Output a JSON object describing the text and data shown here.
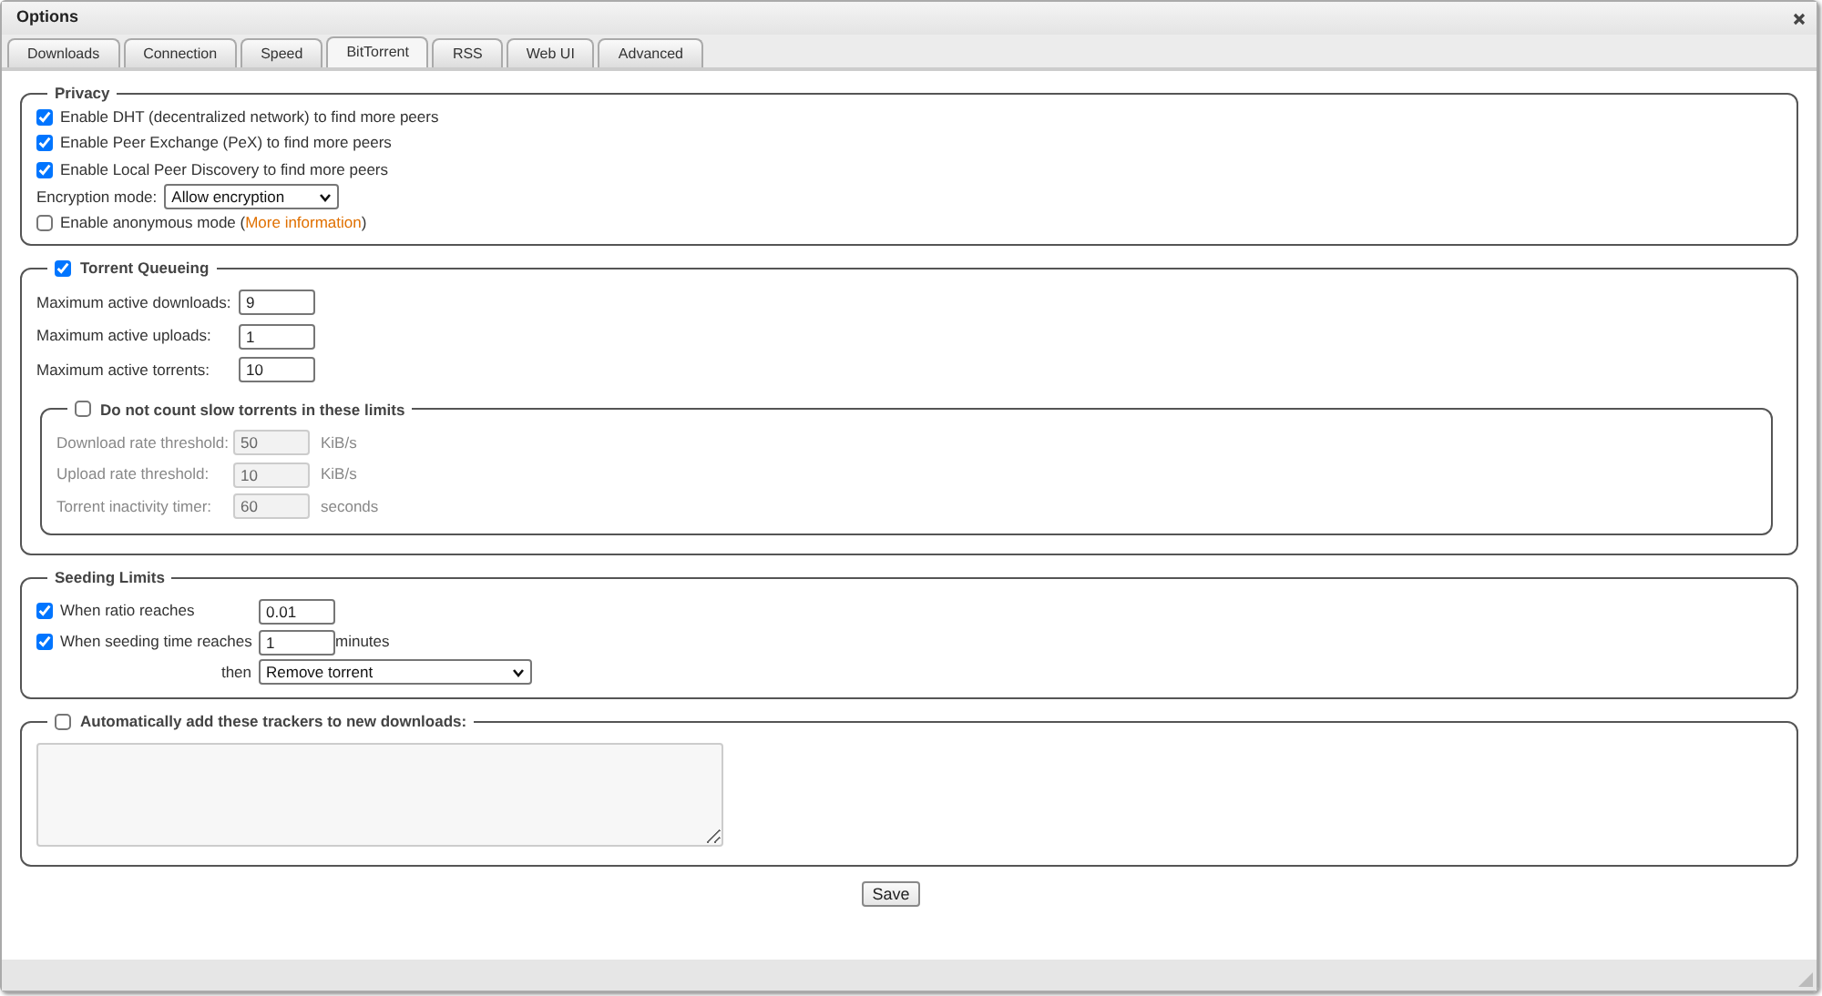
{
  "window": {
    "title": "Options"
  },
  "tabs": [
    {
      "label": "Downloads",
      "selected": false
    },
    {
      "label": "Connection",
      "selected": false
    },
    {
      "label": "Speed",
      "selected": false
    },
    {
      "label": "BitTorrent",
      "selected": true
    },
    {
      "label": "RSS",
      "selected": false
    },
    {
      "label": "Web UI",
      "selected": false
    },
    {
      "label": "Advanced",
      "selected": false
    }
  ],
  "privacy": {
    "legend": "Privacy",
    "options": [
      {
        "label": "Enable DHT (decentralized network) to find more peers",
        "checked": true
      },
      {
        "label": "Enable Peer Exchange (PeX) to find more peers",
        "checked": true
      },
      {
        "label": "Enable Local Peer Discovery to find more peers",
        "checked": true
      }
    ],
    "encryption": {
      "label": "Encryption mode:",
      "value": "Allow encryption"
    },
    "anonymous": {
      "label": "Enable anonymous mode (",
      "link": "More information",
      "after": ")",
      "checked": false
    }
  },
  "queueing": {
    "legend": "Torrent Queueing",
    "checked": true,
    "fields": [
      {
        "label": "Maximum active downloads:",
        "value": "9"
      },
      {
        "label": "Maximum active uploads:",
        "value": "1"
      },
      {
        "label": "Maximum active torrents:",
        "value": "10"
      }
    ],
    "slow": {
      "legend": "Do not count slow torrents in these limits",
      "checked": false,
      "fields": [
        {
          "label": "Download rate threshold:",
          "value": "50",
          "unit": "KiB/s",
          "disabled": true
        },
        {
          "label": "Upload rate threshold:",
          "value": "10",
          "unit": "KiB/s",
          "disabled": true
        },
        {
          "label": "Torrent inactivity timer:",
          "value": "60",
          "unit": "seconds",
          "disabled": true
        }
      ]
    }
  },
  "seeding": {
    "legend": "Seeding Limits",
    "rows": [
      {
        "label": "When ratio reaches",
        "checked": true,
        "value": "0.01"
      },
      {
        "label": "When seeding time reaches",
        "checked": true,
        "value": "1",
        "unit": "minutes"
      }
    ],
    "then": {
      "label": "then",
      "value": "Remove torrent"
    }
  },
  "trackers": {
    "legend": "Automatically add these trackers to new downloads:",
    "checked": false
  },
  "save_button": "Save"
}
